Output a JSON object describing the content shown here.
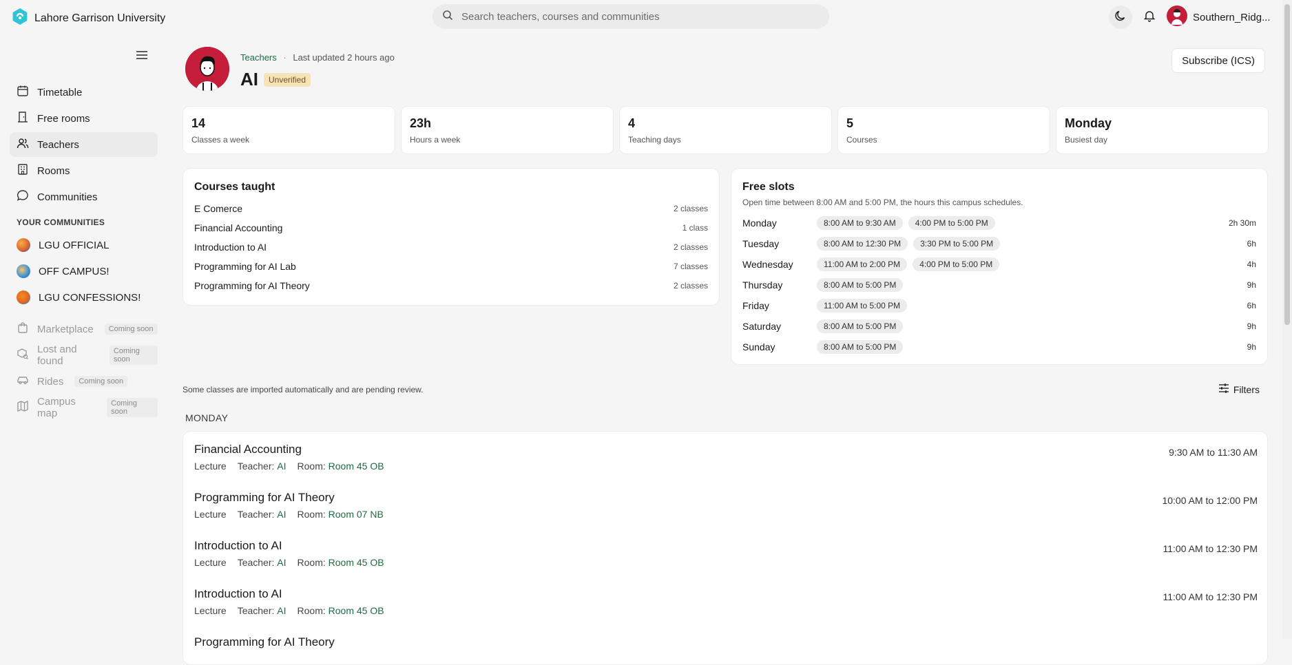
{
  "app": {
    "name": "Lahore Garrison University"
  },
  "search": {
    "placeholder": "Search teachers, courses and communities"
  },
  "user": {
    "name": "Southern_Ridg..."
  },
  "sidebar": {
    "items": [
      {
        "label": "Timetable",
        "icon": "calendar-icon"
      },
      {
        "label": "Free rooms",
        "icon": "door-icon"
      },
      {
        "label": "Teachers",
        "icon": "users-icon"
      },
      {
        "label": "Rooms",
        "icon": "building-icon"
      },
      {
        "label": "Communities",
        "icon": "chat-icon"
      }
    ],
    "communities_title": "YOUR COMMUNITIES",
    "communities": [
      {
        "label": "LGU OFFICIAL",
        "color": "#e0652f"
      },
      {
        "label": "OFF CAMPUS!",
        "color": "#3a8fd8"
      },
      {
        "label": "LGU CONFESSIONS!",
        "color": "#f08a2c"
      }
    ],
    "coming": [
      {
        "label": "Marketplace",
        "badge": "Coming soon"
      },
      {
        "label": "Lost and found",
        "badge": "Coming soon"
      },
      {
        "label": "Rides",
        "badge": "Coming soon"
      },
      {
        "label": "Campus map",
        "badge": "Coming soon"
      }
    ]
  },
  "header": {
    "crumb_link": "Teachers",
    "crumb_sep": "·",
    "updated": "Last updated 2 hours ago",
    "title": "AI",
    "badge": "Unverified",
    "subscribe": "Subscribe (ICS)"
  },
  "stats": [
    {
      "value": "14",
      "label": "Classes a week"
    },
    {
      "value": "23h",
      "label": "Hours a week"
    },
    {
      "value": "4",
      "label": "Teaching days"
    },
    {
      "value": "5",
      "label": "Courses"
    },
    {
      "value": "Monday",
      "label": "Busiest day"
    }
  ],
  "courses": {
    "title": "Courses taught",
    "items": [
      {
        "name": "E Comerce",
        "count": "2 classes"
      },
      {
        "name": "Financial Accounting",
        "count": "1 class"
      },
      {
        "name": "Introduction to AI",
        "count": "2 classes"
      },
      {
        "name": "Programming for AI Lab",
        "count": "7 classes"
      },
      {
        "name": "Programming for AI Theory",
        "count": "2 classes"
      }
    ]
  },
  "slots": {
    "title": "Free slots",
    "desc": "Open time between 8:00 AM and 5:00 PM, the hours this campus schedules.",
    "days": [
      {
        "day": "Monday",
        "chips": [
          "8:00 AM to 9:30 AM",
          "4:00 PM to 5:00 PM"
        ],
        "total": "2h 30m"
      },
      {
        "day": "Tuesday",
        "chips": [
          "8:00 AM to 12:30 PM",
          "3:30 PM to 5:00 PM"
        ],
        "total": "6h"
      },
      {
        "day": "Wednesday",
        "chips": [
          "11:00 AM to 2:00 PM",
          "4:00 PM to 5:00 PM"
        ],
        "total": "4h"
      },
      {
        "day": "Thursday",
        "chips": [
          "8:00 AM to 5:00 PM"
        ],
        "total": "9h"
      },
      {
        "day": "Friday",
        "chips": [
          "11:00 AM to 5:00 PM"
        ],
        "total": "6h"
      },
      {
        "day": "Saturday",
        "chips": [
          "8:00 AM to 5:00 PM"
        ],
        "total": "9h"
      },
      {
        "day": "Sunday",
        "chips": [
          "8:00 AM to 5:00 PM"
        ],
        "total": "9h"
      }
    ]
  },
  "schedule": {
    "note": "Some classes are imported automatically and are pending review.",
    "filters": "Filters",
    "day": "MONDAY",
    "type_label": "Lecture",
    "teacher_label": "Teacher:",
    "room_label": "Room:",
    "classes": [
      {
        "title": "Financial Accounting",
        "teacher": "AI",
        "room": "Room 45 OB",
        "time": "9:30 AM to 11:30 AM"
      },
      {
        "title": "Programming for AI Theory",
        "teacher": "AI",
        "room": "Room 07 NB",
        "time": "10:00 AM to 12:00 PM"
      },
      {
        "title": "Introduction to AI",
        "teacher": "AI",
        "room": "Room 45 OB",
        "time": "11:00 AM to 12:30 PM"
      },
      {
        "title": "Introduction to AI",
        "teacher": "AI",
        "room": "Room 45 OB",
        "time": "11:00 AM to 12:30 PM"
      },
      {
        "title": "Programming for AI Theory",
        "teacher": "",
        "room": "",
        "time": ""
      }
    ]
  }
}
